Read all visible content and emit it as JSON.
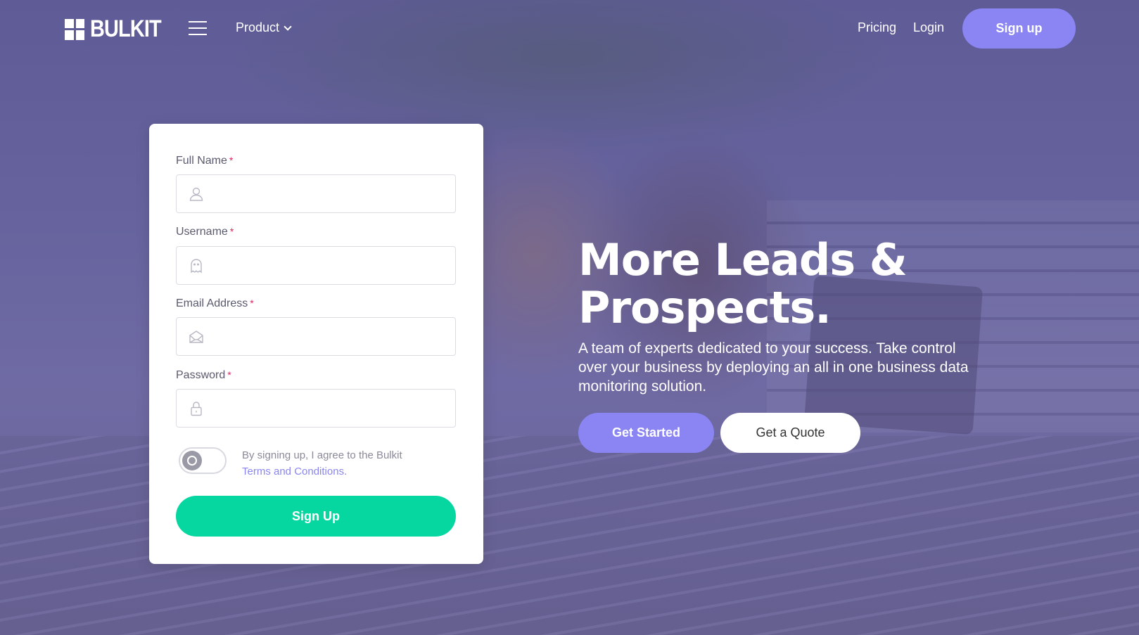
{
  "navbar": {
    "logo_text": "BULKIT",
    "menu_icon": "hamburger-icon",
    "product_label": "Product",
    "pricing_label": "Pricing",
    "login_label": "Login",
    "signup_label": "Sign up"
  },
  "form": {
    "fields": [
      {
        "label": "Full Name",
        "required": "*",
        "icon": "user-icon",
        "value": ""
      },
      {
        "label": "Username",
        "required": "*",
        "icon": "ghost-icon",
        "value": ""
      },
      {
        "label": "Email Address",
        "required": "*",
        "icon": "envelope-icon",
        "value": ""
      },
      {
        "label": "Password",
        "required": "*",
        "icon": "lock-icon",
        "value": ""
      }
    ],
    "terms_text": "By signing up, I agree to the Bulkit",
    "terms_link": "Terms and Conditions.",
    "terms_toggle_on": false,
    "submit_label": "Sign Up"
  },
  "hero": {
    "title_line1": "More Leads &",
    "title_line2": "Prospects.",
    "subtitle": "A team of experts dedicated to your success. Take control over your business by deploying an all in one business data monitoring solution.",
    "cta_primary": "Get Started",
    "cta_secondary": "Get a Quote"
  },
  "colors": {
    "accent": "#8a85f2",
    "success": "#06d6a0",
    "hero_overlay": "#5f5b97",
    "required": "#e0245e"
  }
}
